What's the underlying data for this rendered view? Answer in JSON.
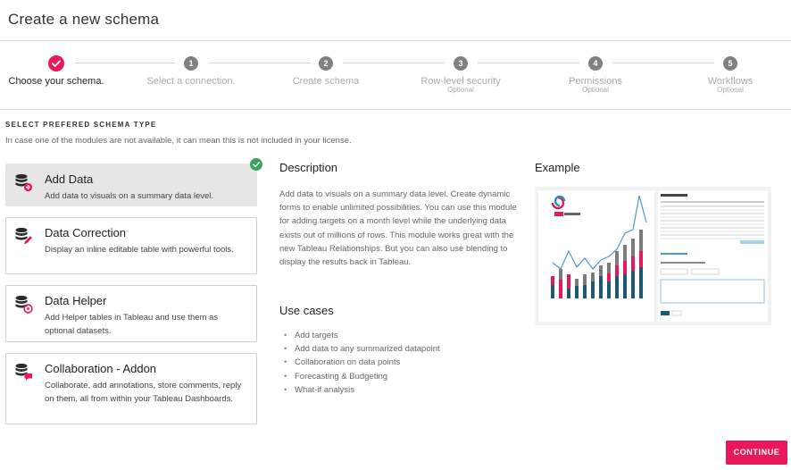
{
  "header": {
    "title": "Create a new schema"
  },
  "stepper": {
    "steps": [
      {
        "number": "",
        "label": "Choose your schema.",
        "sub": ""
      },
      {
        "number": "1",
        "label": "Select a connection.",
        "sub": ""
      },
      {
        "number": "2",
        "label": "Create schema",
        "sub": ""
      },
      {
        "number": "3",
        "label": "Row-level security",
        "sub": "Optional"
      },
      {
        "number": "4",
        "label": "Permissions",
        "sub": "Optional"
      },
      {
        "number": "5",
        "label": "Workflows",
        "sub": "Optional"
      }
    ]
  },
  "section": {
    "title": "SELECT PREFERED SCHEMA TYPE",
    "note": "In case one of the modules are not available, it can mean this is not included in your license."
  },
  "options": [
    {
      "title": "Add Data",
      "desc": "Add data to visuals on a summary data level.",
      "icon": "database-add-icon"
    },
    {
      "title": "Data Correction",
      "desc": "Display an inline editable table with powerful tools.",
      "icon": "database-edit-icon"
    },
    {
      "title": "Data Helper",
      "desc": "Add Helper tables in Tableau and use them as optional datasets.",
      "icon": "database-helper-icon"
    },
    {
      "title": "Collaboration - Addon",
      "desc": "Collaborate, add annotations, store comments, reply on them, all from within your Tableau Dashboards.",
      "icon": "database-comment-icon"
    }
  ],
  "description": {
    "heading": "Description",
    "text": "Add data to visuals on a summary data level. Create dynamic forms to enable unlimited possibilities. You can use this module for adding targets on a month level while the underlying data exists out of millions of rows. This module works great with the new Tableau Relationships. But you can also use blending to display the results back in Tableau."
  },
  "use_cases": {
    "heading": "Use cases",
    "items": [
      "Add targets",
      "Add data to any summarized datapoint",
      "Collaboration on data points",
      "Forecasting & Budgeting",
      "What-if analysis"
    ]
  },
  "example": {
    "heading": "Example"
  },
  "actions": {
    "continue": "CONTINUE"
  },
  "colors": {
    "accent": "#e8185a",
    "success": "#3aa35b",
    "step_inactive": "#808080",
    "selected_bg": "#e6e6e6"
  }
}
